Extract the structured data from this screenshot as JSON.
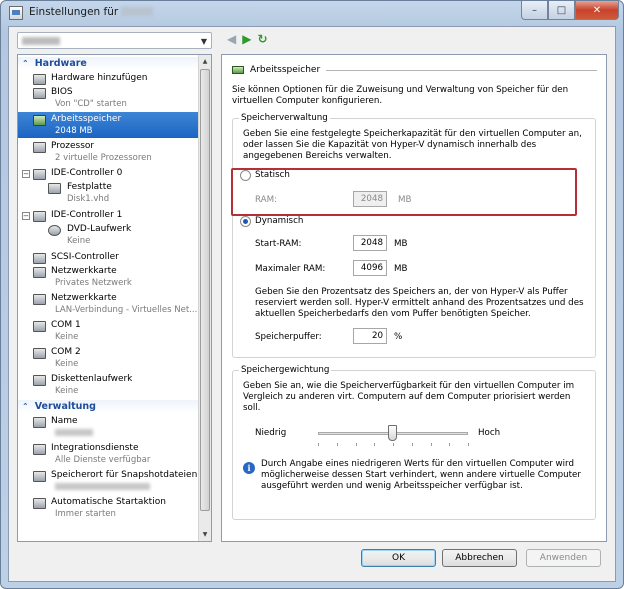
{
  "window": {
    "title": "Einstellungen für",
    "minimize": "–",
    "maximize": "□",
    "close": "✕"
  },
  "nav": {
    "back": "◀",
    "forward": "▶",
    "refresh": "↻"
  },
  "sidebar": {
    "hardware_header": "Hardware",
    "management_header": "Verwaltung",
    "items": [
      {
        "label": "Hardware hinzufügen",
        "sub": ""
      },
      {
        "label": "BIOS",
        "sub": "Von \"CD\" starten"
      },
      {
        "label": "Arbeitsspeicher",
        "sub": "2048 MB"
      },
      {
        "label": "Prozessor",
        "sub": "2 virtuelle Prozessoren"
      },
      {
        "label": "IDE-Controller 0",
        "sub": ""
      },
      {
        "label": "Festplatte",
        "sub": "Disk1.vhd"
      },
      {
        "label": "IDE-Controller 1",
        "sub": ""
      },
      {
        "label": "DVD-Laufwerk",
        "sub": "Keine"
      },
      {
        "label": "SCSI-Controller",
        "sub": ""
      },
      {
        "label": "Netzwerkkarte",
        "sub": "Privates Netzwerk"
      },
      {
        "label": "Netzwerkkarte",
        "sub": "LAN-Verbindung - Virtuelles Net..."
      },
      {
        "label": "COM 1",
        "sub": "Keine"
      },
      {
        "label": "COM 2",
        "sub": "Keine"
      },
      {
        "label": "Diskettenlaufwerk",
        "sub": "Keine"
      },
      {
        "label": "Name",
        "sub": ""
      },
      {
        "label": "Integrationsdienste",
        "sub": "Alle Dienste verfügbar"
      },
      {
        "label": "Speicherort für Snapshotdateien",
        "sub": ""
      },
      {
        "label": "Automatische Startaktion",
        "sub": "Immer starten"
      }
    ]
  },
  "panel": {
    "title": "Arbeitsspeicher",
    "intro": "Sie können Optionen für die Zuweisung und Verwaltung von Speicher für den virtuellen Computer konfigurieren.",
    "memory_mgmt": {
      "title": "Speicherverwaltung",
      "desc": "Geben Sie eine festgelegte Speicherkapazität für den virtuellen Computer an, oder lassen Sie die Kapazität von Hyper-V dynamisch innerhalb des angegebenen Bereichs verwalten.",
      "static_label": "Statisch",
      "ram_label": "RAM:",
      "ram_value": "2048",
      "unit_mb": "MB",
      "dynamic_label": "Dynamisch",
      "start_ram_label": "Start-RAM:",
      "start_ram_value": "2048",
      "max_ram_label": "Maximaler RAM:",
      "max_ram_value": "4096",
      "buffer_desc": "Geben Sie den Prozentsatz des Speichers an, der von Hyper-V als Puffer reserviert werden soll. Hyper-V ermittelt anhand des Prozentsatzes und des aktuellen Speicherbedarfs den vom Puffer benötigten Speicher.",
      "buffer_label": "Speicherpuffer:",
      "buffer_value": "20",
      "percent": "%"
    },
    "weight": {
      "title": "Speichergewichtung",
      "desc": "Geben Sie an, wie die Speicherverfügbarkeit für den virtuellen Computer im Vergleich zu anderen virt. Computern auf dem Computer priorisiert werden soll.",
      "low": "Niedrig",
      "high": "Hoch",
      "level": 0.5,
      "info": "Durch Angabe eines niedrigeren Werts für den virtuellen Computer wird möglicherweise dessen Start verhindert, wenn andere virtuelle Computer ausgeführt werden und wenig Arbeitsspeicher verfügbar ist."
    }
  },
  "buttons": {
    "ok": "OK",
    "cancel": "Abbrechen",
    "apply": "Anwenden"
  }
}
